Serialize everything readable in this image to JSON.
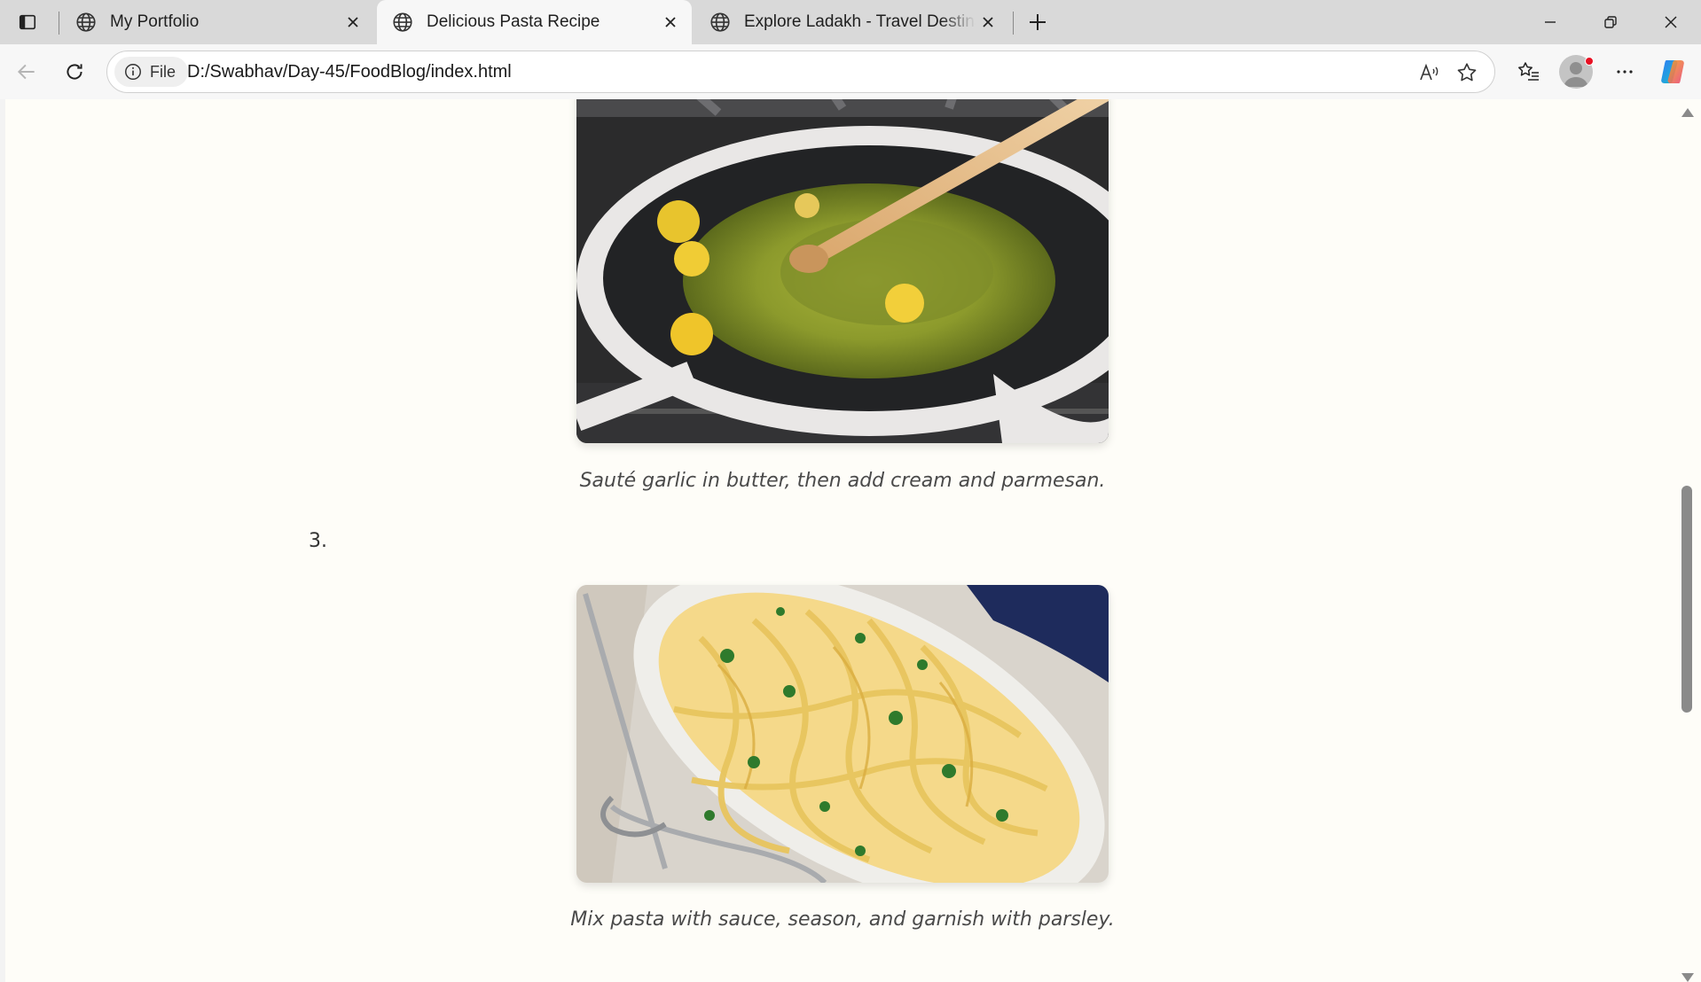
{
  "browser": {
    "tabs": [
      {
        "title": "My Portfolio",
        "active": false
      },
      {
        "title": "Delicious Pasta Recipe",
        "active": true
      },
      {
        "title": "Explore Ladakh - Travel Destination",
        "active": false
      }
    ],
    "address": {
      "site_info_label": "File",
      "url": "D:/Swabhav/Day-45/FoodBlog/index.html"
    },
    "accent_color": "#0078d4"
  },
  "page": {
    "background": "#fefdf8",
    "steps": [
      {
        "image_icon": "garlic-butter-skillet-image",
        "caption": "Sauté garlic in butter, then add cream and parmesan."
      },
      {
        "number": "3.",
        "image_icon": "fettuccine-parsley-image",
        "caption": "Mix pasta with sauce, season, and garnish with parsley."
      }
    ]
  }
}
